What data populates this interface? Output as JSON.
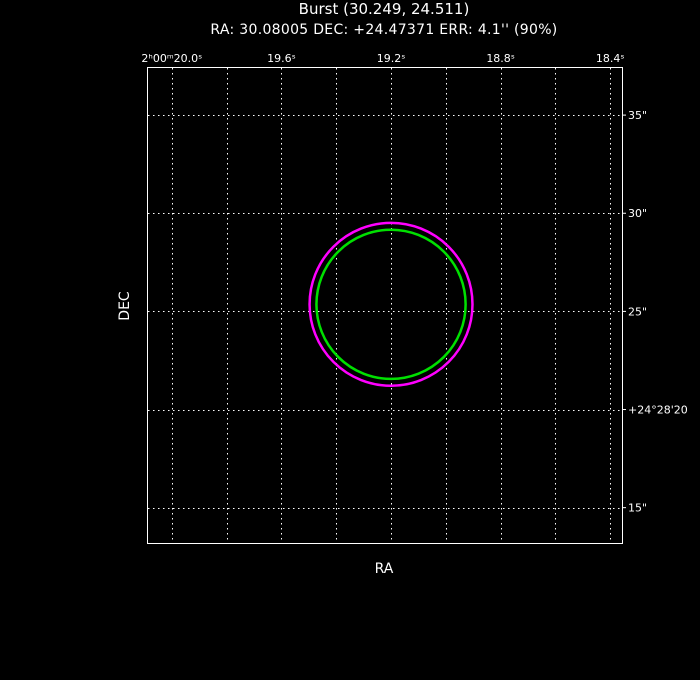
{
  "chart_data": {
    "type": "scatter",
    "title": "Burst (30.249, 24.511)",
    "subtitle": "RA: 30.08005   DEC: +24.47371   ERR: 4.1'' (90%)",
    "xlabel": "RA",
    "ylabel": "DEC",
    "x_ticks": [
      {
        "value": 20.0,
        "label": "2ʰ00ᵐ20.0ˢ"
      },
      {
        "value": 19.6,
        "label": "19.6ˢ"
      },
      {
        "value": 19.2,
        "label": "19.2ˢ"
      },
      {
        "value": 18.8,
        "label": "18.8ˢ"
      },
      {
        "value": 18.4,
        "label": "18.4ˢ"
      }
    ],
    "x_minor_grid": [
      20.0,
      19.8,
      19.6,
      19.4,
      19.2,
      19.0,
      18.8,
      18.6,
      18.4
    ],
    "xlim": [
      20.087,
      18.357
    ],
    "y_ticks": [
      {
        "value": 35,
        "label": "35\""
      },
      {
        "value": 30,
        "label": "30\""
      },
      {
        "value": 25,
        "label": "25\""
      },
      {
        "value": 20,
        "label": "+24°28'20"
      },
      {
        "value": 15,
        "label": "15\""
      }
    ],
    "ylim": [
      13.2,
      37.4
    ],
    "grid": true,
    "series": [
      {
        "kind": "error_circle",
        "center": [
          19.2,
          25.36
        ],
        "radius_arcsec": 4.15,
        "color": "#ff00ff"
      },
      {
        "kind": "error_circle",
        "center": [
          19.2,
          25.36
        ],
        "radius_arcsec": 3.8,
        "color": "#00e000"
      }
    ]
  }
}
